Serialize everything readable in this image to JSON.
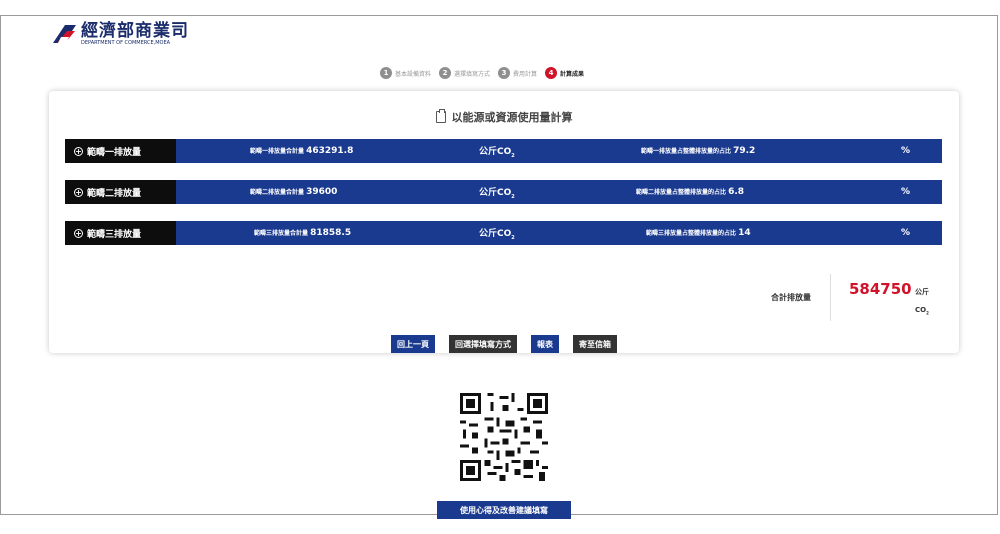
{
  "header": {
    "logo_title": "經濟部商業司",
    "logo_subtitle": "DEPARTMENT OF COMMERCE,MOEA"
  },
  "steps": [
    {
      "num": "1",
      "label": "基本設備資料",
      "active": false
    },
    {
      "num": "2",
      "label": "選擇填寫方式",
      "active": false
    },
    {
      "num": "3",
      "label": "費用計算",
      "active": false
    },
    {
      "num": "4",
      "label": "計算成果",
      "active": true
    }
  ],
  "card": {
    "title": "以能源或資源使用量計算"
  },
  "scopes": [
    {
      "label": "範疇一排放量",
      "total_label": "範疇一排放量合計量",
      "total_value": "463291.8",
      "unit": "公斤CO",
      "unit_sub": "2",
      "pct_label": "範疇一排放量占整體排放量的占比",
      "pct_value": "79.2",
      "pct_symbol": "%"
    },
    {
      "label": "範疇二排放量",
      "total_label": "範疇二排放量合計量",
      "total_value": "39600",
      "unit": "公斤CO",
      "unit_sub": "2",
      "pct_label": "範疇二排放量占整體排放量的占比",
      "pct_value": "6.8",
      "pct_symbol": "%"
    },
    {
      "label": "範疇三排放量",
      "total_label": "範疇三排放量合計量",
      "total_value": "81858.5",
      "unit": "公斤CO",
      "unit_sub": "2",
      "pct_label": "範疇三排放量占整體排放量的占比",
      "pct_value": "14",
      "pct_symbol": "%"
    }
  ],
  "total": {
    "label": "合計排放量",
    "value": "584750",
    "unit": "公斤",
    "co2": "CO",
    "co2_sub": "2"
  },
  "buttons": {
    "prev": "回上一頁",
    "choose_method": "回選擇填寫方式",
    "report": "報表",
    "email": "寄至信箱"
  },
  "feedback_button": "使用心得及改善建議填寫",
  "colors": {
    "primary_blue": "#1a3a8f",
    "accent_red": "#d0132a",
    "dark": "#333333"
  }
}
